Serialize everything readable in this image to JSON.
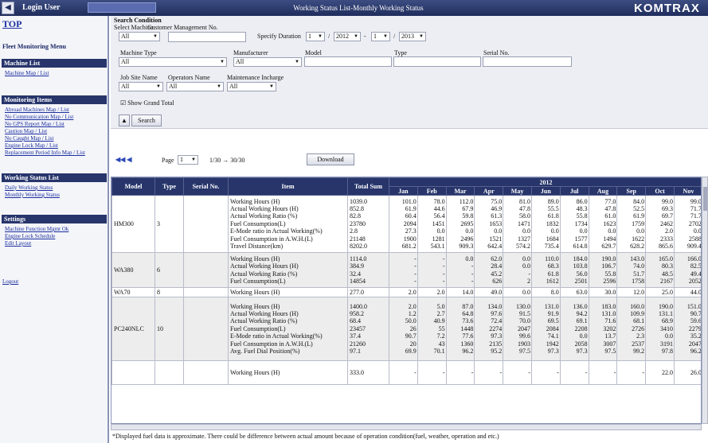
{
  "topbar": {
    "back_glyph": "◀",
    "login_user": "Login User",
    "title": "Working Status List-Monthly Working Status",
    "brand": "KOMTRAX"
  },
  "sidebar": {
    "top": "TOP",
    "main_title": "Fleet Monitoring Menu",
    "sections": [
      {
        "title": "Machine List",
        "links": [
          "Machine Map / List"
        ]
      },
      {
        "title": "Monitoring Items",
        "links": [
          "Abroad Machines Map / List",
          "No Communication Map / List",
          "No GPS Report Map / List",
          "Caution Map / List",
          "No Caught Map / List",
          "Engine Lock Map / List",
          "Replacement Period Info Map / List"
        ]
      },
      {
        "title": "Working Status List",
        "links": [
          "Daily Working Status",
          "Monthly Working Status"
        ]
      },
      {
        "title": "Settings",
        "links": [
          "Machine Function Mgmt Ok",
          "Engine Lock Schedule",
          "Edit Layout"
        ]
      }
    ],
    "logout": "Logout"
  },
  "search": {
    "heading": "Search Condition",
    "select_machine_label": "Select Machine",
    "customer_label": "Customer Management No.",
    "select_machine_value": "All",
    "specify_duration_label": "Specify Duration",
    "duration": {
      "from_month": "1",
      "from_year": "2012",
      "to_month": "1",
      "to_year": "2013"
    },
    "labels": {
      "machine_type": "Machine Type",
      "manufacturer": "Manufacturer",
      "model": "Model",
      "type": "Type",
      "serial": "Serial No.",
      "jobsite": "Job Site Name",
      "operator": "Operators Name",
      "maintenance": "Maintenance Incharge"
    },
    "values": {
      "machine_type": "All",
      "manufacturer": "All",
      "jobsite": "All",
      "operator": "All",
      "maintenance": "All"
    },
    "grand_total_label": "Show Grand Total",
    "collapse_glyph": "▲",
    "search_button": "Search"
  },
  "pager": {
    "page_label": "Page",
    "page_value": "1",
    "range": "1/30 → 30/30",
    "download": "Download"
  },
  "grid": {
    "headers": {
      "model": "Model",
      "type": "Type",
      "serial": "Serial No.",
      "item": "Item",
      "total": "Total Sum",
      "year": "2012"
    },
    "months": [
      "Jan",
      "Feb",
      "Mar",
      "Apr",
      "May",
      "Jun",
      "Jul",
      "Aug",
      "Sep",
      "Oct",
      "Nov"
    ],
    "rows": [
      {
        "model": "HM300",
        "type": "3",
        "serial": "",
        "items": [
          "Working Hours (H)",
          "Actual Working Hours (H)",
          "Actual Working Ratio (%)",
          "Fuel Consumption(L)",
          "E-Mode ratio in Actual Working(%)",
          "Fuel Consumption in A.W.H.(L)",
          "Travel Distance(km)"
        ],
        "totals": [
          "1039.0",
          "852.8",
          "82.8",
          "23780",
          "2.8",
          "21148",
          "8202.0"
        ],
        "months": [
          [
            "101.0",
            "78.0",
            "112.0",
            "75.0",
            "81.0",
            "89.0",
            "86.0",
            "77.0",
            "84.0",
            "99.0",
            "99.0"
          ],
          [
            "61.9",
            "44.6",
            "67.9",
            "46.9",
            "47.8",
            "55.5",
            "48.3",
            "47.8",
            "52.5",
            "69.3",
            "71.7"
          ],
          [
            "60.4",
            "56.4",
            "59.8",
            "61.3",
            "58.0",
            "61.8",
            "55.8",
            "61.0",
            "61.9",
            "69.7",
            "71.7"
          ],
          [
            "2094",
            "1451",
            "2695",
            "1653",
            "1471",
            "1832",
            "1734",
            "1623",
            "1759",
            "2462",
            "2702"
          ],
          [
            "27.3",
            "0.0",
            "0.0",
            "0.0",
            "0.0",
            "0.0",
            "0.0",
            "0.0",
            "0.0",
            "2.0",
            "0.0"
          ],
          [
            "1900",
            "1281",
            "2496",
            "1521",
            "1327",
            "1684",
            "1577",
            "1494",
            "1622",
            "2333",
            "2588"
          ],
          [
            "681.2",
            "543.1",
            "909.3",
            "642.4",
            "574.2",
            "735.4",
            "614.8",
            "629.7",
            "628.2",
            "865.6",
            "909.4"
          ]
        ]
      },
      {
        "model": "WA380",
        "type": "6",
        "serial": "",
        "items": [
          "Working Hours (H)",
          "Actual Working Hours (H)",
          "Actual Working Ratio (%)",
          "Fuel Consumption(L)"
        ],
        "totals": [
          "1114.0",
          "384.9",
          "32.4",
          "14854"
        ],
        "months": [
          [
            "-",
            "-",
            "0.0",
            "62.0",
            "0.0",
            "110.0",
            "184.0",
            "190.0",
            "143.0",
            "165.0",
            "166.0"
          ],
          [
            "-",
            "-",
            "-",
            "28.4",
            "0.0",
            "68.3",
            "103.8",
            "106.7",
            "74.0",
            "80.3",
            "82.5"
          ],
          [
            "-",
            "-",
            "-",
            "45.2",
            "-",
            "61.8",
            "56.0",
            "55.8",
            "51.7",
            "48.5",
            "49.4"
          ],
          [
            "-",
            "-",
            "-",
            "626",
            "2",
            "1612",
            "2501",
            "2596",
            "1758",
            "2167",
            "2052"
          ]
        ]
      },
      {
        "model": "WA70",
        "type": "8",
        "serial": "",
        "items": [
          "Working Hours (H)"
        ],
        "totals": [
          "277.0"
        ],
        "months": [
          [
            "2.0",
            "2.0",
            "14.0",
            "49.0",
            "0.0",
            "8.0",
            "63.0",
            "30.0",
            "12.0",
            "25.0",
            "44.0"
          ]
        ]
      },
      {
        "model": "PC240NLC",
        "type": "10",
        "serial": "",
        "items": [
          "Working Hours (H)",
          "Actual Working Hours (H)",
          "Actual Working Ratio (%)",
          "Fuel Consumption(L)",
          "E-Mode ratio in Actual Working(%)",
          "Fuel Consumption in A.W.H.(L)",
          "Avg. Fuel Dial Position(%)"
        ],
        "totals": [
          "1400.0",
          "958.2",
          "68.4",
          "23457",
          "37.4",
          "21260",
          "97.1"
        ],
        "months": [
          [
            "2.0",
            "5.0",
            "87.0",
            "134.0",
            "130.0",
            "131.0",
            "136.0",
            "183.0",
            "160.0",
            "190.0",
            "151.0"
          ],
          [
            "1.2",
            "2.7",
            "64.8",
            "97.6",
            "91.5",
            "91.9",
            "94.2",
            "131.0",
            "109.9",
            "131.1",
            "90.7"
          ],
          [
            "50.0",
            "40.9",
            "73.6",
            "72.4",
            "70.0",
            "69.5",
            "69.1",
            "71.6",
            "68.1",
            "68.9",
            "59.6"
          ],
          [
            "26",
            "55",
            "1448",
            "2274",
            "2047",
            "2084",
            "2208",
            "3202",
            "2726",
            "3410",
            "2279"
          ],
          [
            "90.7",
            "7.2",
            "77.6",
            "97.3",
            "99.6",
            "74.1",
            "0.0",
            "13.7",
            "2.3",
            "0.0",
            "35.2"
          ],
          [
            "20",
            "43",
            "1360",
            "2135",
            "1903",
            "1942",
            "2058",
            "3007",
            "2537",
            "3191",
            "2047"
          ],
          [
            "69.9",
            "70.1",
            "96.2",
            "95.2",
            "97.5",
            "97.3",
            "97.3",
            "97.5",
            "99.2",
            "97.8",
            "96.2"
          ]
        ]
      },
      {
        "model": "",
        "type": "",
        "serial": "",
        "items": [
          "Working Hours (H)"
        ],
        "totals": [
          "333.0"
        ],
        "months": [
          [
            "-",
            "-",
            "-",
            "-",
            "-",
            "-",
            "-",
            "-",
            "-",
            "22.0",
            "26.0"
          ]
        ]
      }
    ]
  },
  "footnote": "*Displayed fuel data is approximate. There could be difference between actual amount because of operation condition(fuel, weather, operation and etc.)"
}
